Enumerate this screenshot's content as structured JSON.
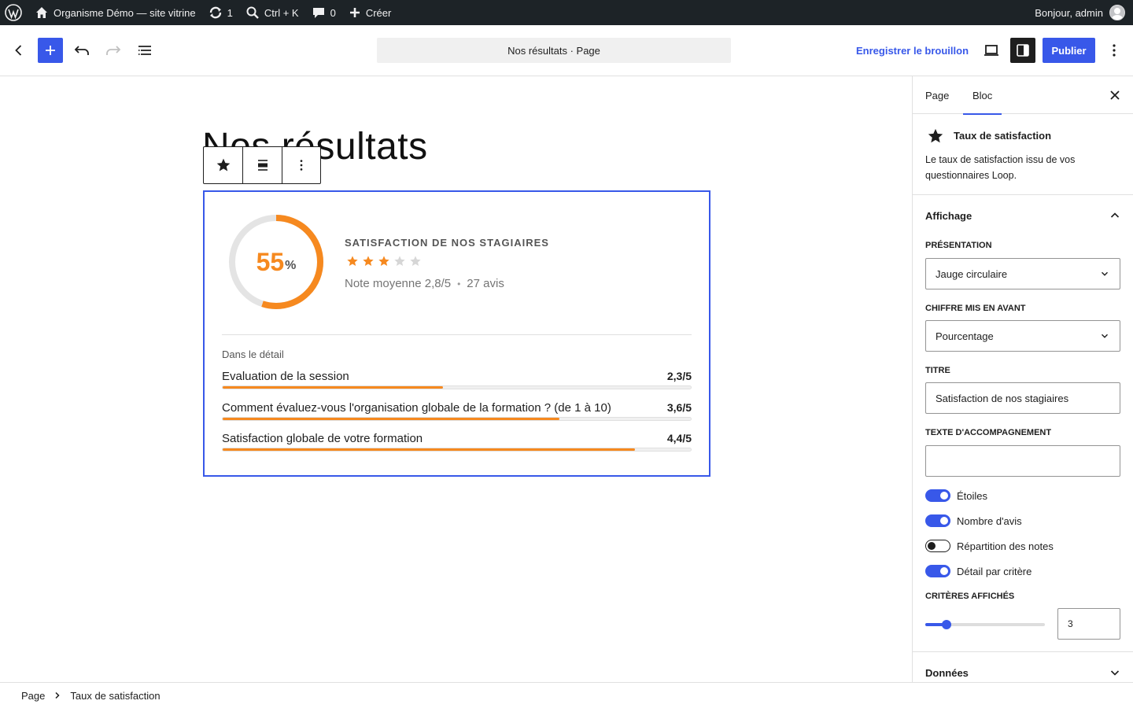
{
  "adminbar": {
    "site_name": "Organisme Démo — site vitrine",
    "updates_count": "1",
    "search_shortcut": "Ctrl + K",
    "comments_count": "0",
    "new_label": "Créer",
    "greeting": "Bonjour, admin"
  },
  "header": {
    "document_title": "Nos résultats · Page",
    "save_draft_label": "Enregistrer le brouillon",
    "publish_label": "Publier"
  },
  "canvas": {
    "page_heading": "Nos résultats",
    "block": {
      "gauge_value": "55",
      "gauge_unit": "%",
      "gauge_fraction": 0.55,
      "title": "SATISFACTION DE NOS STAGIAIRES",
      "stars_filled": 3,
      "stars_total": 5,
      "average_label": "Note moyenne 2,8/5",
      "reviews_label": "27 avis",
      "detail_heading": "Dans le détail",
      "criteria": [
        {
          "label": "Evaluation de la session",
          "score": "2,3/5",
          "fraction": 0.47
        },
        {
          "label": "Comment évaluez-vous l'organisation globale de la formation ? (de 1 à 10)",
          "score": "3,6/5",
          "fraction": 0.72
        },
        {
          "label": "Satisfaction globale de votre formation",
          "score": "4,4/5",
          "fraction": 0.88
        }
      ]
    }
  },
  "sidebar": {
    "tab_page": "Page",
    "tab_block": "Bloc",
    "block_name": "Taux de satisfaction",
    "block_description": "Le taux de satisfaction issu de vos questionnaires Loop.",
    "panel_display": "Affichage",
    "presentation_label": "PRÉSENTATION",
    "presentation_value": "Jauge circulaire",
    "highlight_label": "CHIFFRE MIS EN AVANT",
    "highlight_value": "Pourcentage",
    "title_label": "TITRE",
    "title_value": "Satisfaction de nos stagiaires",
    "subtext_label": "TEXTE D'ACCOMPAGNEMENT",
    "subtext_value": "",
    "toggles": [
      {
        "label": "Étoiles",
        "on": true
      },
      {
        "label": "Nombre d'avis",
        "on": true
      },
      {
        "label": "Répartition des notes",
        "on": false
      },
      {
        "label": "Détail par critère",
        "on": true
      }
    ],
    "criteria_shown_label": "CRITÈRES AFFICHÉS",
    "criteria_shown_value": "3",
    "criteria_shown_fraction": 0.18,
    "panel_data": "Données"
  },
  "footer": {
    "crumb_root": "Page",
    "crumb_current": "Taux de satisfaction"
  },
  "colors": {
    "accent": "#3858e9",
    "gauge": "#f6891f",
    "adminbar": "#1d2327"
  }
}
